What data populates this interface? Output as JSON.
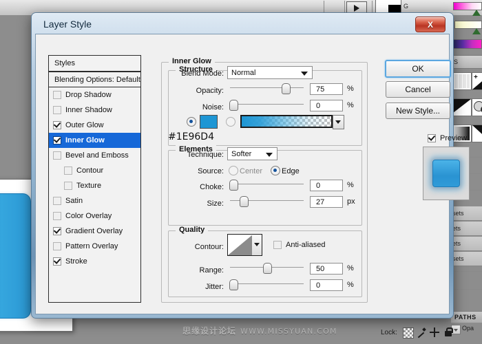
{
  "app": {
    "g_label": "G",
    "panel_tab": "S",
    "presets": [
      "sets",
      "ets",
      "ets",
      "sets"
    ],
    "paths_tab": "PATHS",
    "opacity_label": "Opa",
    "lock_label": "Lock:",
    "lock_icons": [
      "transparency-lock-icon",
      "brush-lock-icon",
      "move-lock-icon",
      "all-lock-icon"
    ],
    "watermark_cn": "思缘设计论坛",
    "watermark_url": "WWW.MISSYUAN.COM"
  },
  "dialog": {
    "title": "Layer Style",
    "close_label": "X",
    "buttons": {
      "ok": "OK",
      "cancel": "Cancel",
      "new_style": "New Style..."
    },
    "preview": {
      "label": "Preview",
      "checked": true
    }
  },
  "styles_panel": {
    "header": "Styles",
    "blending_options": "Blending Options: Default",
    "items": [
      {
        "label": "Drop Shadow",
        "checked": false,
        "sub": false,
        "selected": false
      },
      {
        "label": "Inner Shadow",
        "checked": false,
        "sub": false,
        "selected": false
      },
      {
        "label": "Outer Glow",
        "checked": true,
        "sub": false,
        "selected": false
      },
      {
        "label": "Inner Glow",
        "checked": true,
        "sub": false,
        "selected": true
      },
      {
        "label": "Bevel and Emboss",
        "checked": false,
        "sub": false,
        "selected": false
      },
      {
        "label": "Contour",
        "checked": false,
        "sub": true,
        "selected": false
      },
      {
        "label": "Texture",
        "checked": false,
        "sub": true,
        "selected": false
      },
      {
        "label": "Satin",
        "checked": false,
        "sub": false,
        "selected": false
      },
      {
        "label": "Color Overlay",
        "checked": false,
        "sub": false,
        "selected": false
      },
      {
        "label": "Gradient Overlay",
        "checked": true,
        "sub": false,
        "selected": false
      },
      {
        "label": "Pattern Overlay",
        "checked": false,
        "sub": false,
        "selected": false
      },
      {
        "label": "Stroke",
        "checked": true,
        "sub": false,
        "selected": false
      }
    ]
  },
  "inner_glow": {
    "section_title": "Inner Glow",
    "structure": {
      "legend": "Structure",
      "blend_mode_label": "Blend Mode:",
      "blend_mode_value": "Normal",
      "opacity_label": "Opacity:",
      "opacity_value": "75",
      "opacity_unit": "%",
      "noise_label": "Noise:",
      "noise_value": "0",
      "noise_unit": "%",
      "fill_type": "color",
      "color_hex": "#1E96D4",
      "hex_caption": "#1E96D4"
    },
    "elements": {
      "legend": "Elements",
      "technique_label": "Technique:",
      "technique_value": "Softer",
      "source_label": "Source:",
      "source_center": "Center",
      "source_edge": "Edge",
      "source_value": "Edge",
      "choke_label": "Choke:",
      "choke_value": "0",
      "choke_unit": "%",
      "size_label": "Size:",
      "size_value": "27",
      "size_unit": "px"
    },
    "quality": {
      "legend": "Quality",
      "contour_label": "Contour:",
      "anti_aliased_label": "Anti-aliased",
      "anti_aliased_checked": false,
      "range_label": "Range:",
      "range_value": "50",
      "range_unit": "%",
      "jitter_label": "Jitter:",
      "jitter_value": "0",
      "jitter_unit": "%"
    }
  }
}
